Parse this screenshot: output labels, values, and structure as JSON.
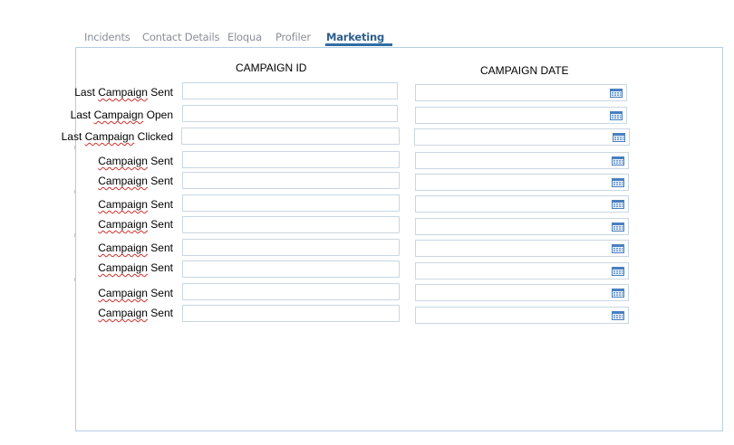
{
  "tabs": [
    {
      "label": "Incidents",
      "active": false
    },
    {
      "label": "Contact Details",
      "active": false
    },
    {
      "label": "Eloqua",
      "active": false
    },
    {
      "label": "Profiler",
      "active": false
    },
    {
      "label": "Marketing",
      "active": true
    }
  ],
  "columns": {
    "id_header": "CAMPAIGN ID",
    "date_header": "CAMPAIGN DATE"
  },
  "rows": [
    {
      "label_pre": "Last ",
      "label_word": "Campaign",
      "label_post": " Sent",
      "id_value": "",
      "date_value": ""
    },
    {
      "label_pre": "Last ",
      "label_word": "Campaign",
      "label_post": " Open",
      "id_value": "",
      "date_value": ""
    },
    {
      "label_pre": "Last ",
      "label_word": "Campaign",
      "label_post": " Clicked",
      "id_value": "",
      "date_value": ""
    },
    {
      "label_pre": "",
      "label_word": "Campaign",
      "label_post": " Sent",
      "id_value": "",
      "date_value": ""
    },
    {
      "label_pre": "",
      "label_word": "Campaign",
      "label_post": " Sent",
      "id_value": "",
      "date_value": ""
    },
    {
      "label_pre": "",
      "label_word": "Campaign",
      "label_post": " Sent",
      "id_value": "",
      "date_value": ""
    },
    {
      "label_pre": "",
      "label_word": "Campaign",
      "label_post": " Sent",
      "id_value": "",
      "date_value": ""
    },
    {
      "label_pre": "",
      "label_word": "Campaign",
      "label_post": " Sent",
      "id_value": "",
      "date_value": ""
    },
    {
      "label_pre": "",
      "label_word": "Campaign",
      "label_post": " Sent",
      "id_value": "",
      "date_value": ""
    },
    {
      "label_pre": "",
      "label_word": "Campaign",
      "label_post": " Sent",
      "id_value": "",
      "date_value": ""
    },
    {
      "label_pre": "",
      "label_word": "Campaign",
      "label_post": " Sent",
      "id_value": "",
      "date_value": ""
    }
  ],
  "icons": {
    "date_picker": "calendar-icon"
  },
  "colors": {
    "active_tab": "#2e5f8e",
    "tab_underline": "#2e6da4",
    "panel_border": "#b5cfe2",
    "spellcheck": "#d0312d"
  }
}
